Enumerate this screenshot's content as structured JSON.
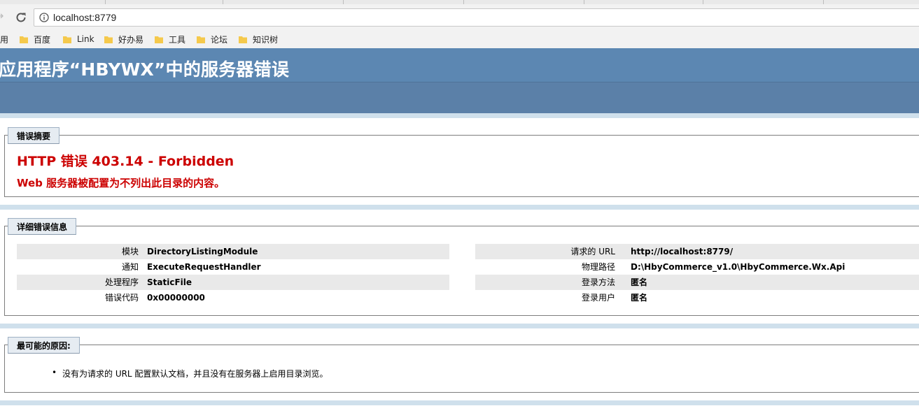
{
  "browser": {
    "url": "localhost:8779",
    "bookmarks": [
      {
        "label": "百度"
      },
      {
        "label": "Link"
      },
      {
        "label": "好办易"
      },
      {
        "label": "工具"
      },
      {
        "label": "论坛"
      },
      {
        "label": "知识树"
      }
    ],
    "apps_label": "应用"
  },
  "page": {
    "banner_title": "应用程序“HBYWX”中的服务器错误"
  },
  "summary": {
    "legend": "错误摘要",
    "title": "HTTP 错误 403.14 - Forbidden",
    "subtitle": "Web 服务器被配置为不列出此目录的内容。"
  },
  "details": {
    "legend": "详细错误信息",
    "left": [
      {
        "label": "模块",
        "value": "DirectoryListingModule"
      },
      {
        "label": "通知",
        "value": "ExecuteRequestHandler"
      },
      {
        "label": "处理程序",
        "value": "StaticFile"
      },
      {
        "label": "错误代码",
        "value": "0x00000000"
      }
    ],
    "right": [
      {
        "label": "请求的 URL",
        "value": "http://localhost:8779/"
      },
      {
        "label": "物理路径",
        "value": "D:\\HbyCommerce_v1.0\\HbyCommerce.Wx.Api"
      },
      {
        "label": "登录方法",
        "value": "匿名"
      },
      {
        "label": "登录用户",
        "value": "匿名"
      }
    ]
  },
  "causes": {
    "legend": "最可能的原因:",
    "items": [
      "没有为请求的 URL 配置默认文档，并且没有在服务器上启用目录浏览。"
    ]
  },
  "colors": {
    "banner": "#5c87b2",
    "error_red": "#cc0000",
    "stripe": "#cfe0ec"
  }
}
